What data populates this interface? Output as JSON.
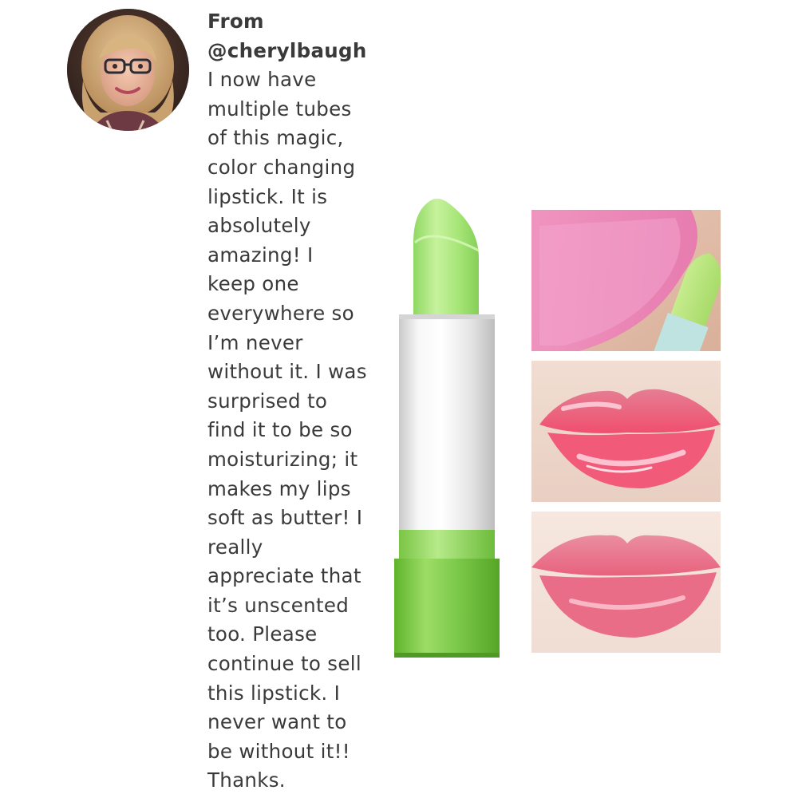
{
  "post": {
    "from_label": "From",
    "handle": "@cherylbaugh",
    "review_lines": [
      "I now have",
      "multiple tubes",
      "of this magic,",
      "color changing",
      "lipstick. It is",
      "absolutely",
      "amazing! I",
      "keep one",
      "everywhere so",
      "I’m never",
      "without it. I was",
      "surprised to",
      "find it to be so",
      "moisturizing; it",
      "makes my lips",
      "soft as butter! I",
      "really",
      "appreciate that",
      "it’s unscented",
      "too. Please",
      "continue to sell",
      "this lipstick. I",
      "never want to",
      "be without it!!",
      "Thanks."
    ]
  },
  "colors": {
    "text": "#3a3a3a",
    "balm_green": "#a8e67a",
    "tube_silver": "#e8e8e8",
    "base_green": "#7cc94a",
    "lip_pink": "#e86a86"
  },
  "icons": {
    "avatar": "user-profile-photo",
    "product": "lipstick-product-image",
    "swatches": [
      "pink-swatch-photo",
      "glossy-lips-photo",
      "tinted-lips-photo"
    ]
  }
}
